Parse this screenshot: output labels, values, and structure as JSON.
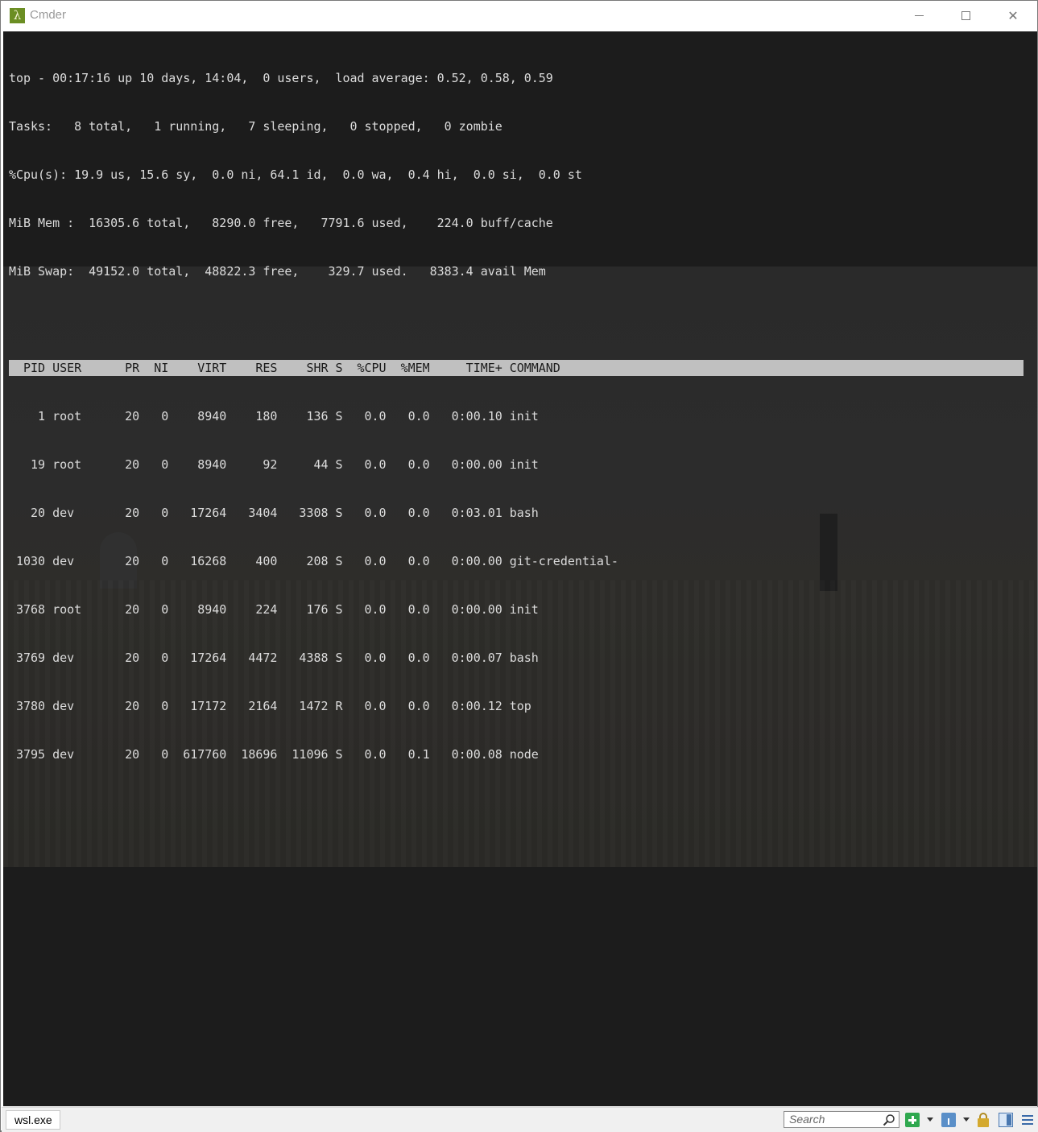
{
  "window": {
    "title": "Cmder",
    "app_icon_glyph": "λ",
    "minimize_icon": "minimize-icon",
    "maximize_icon": "maximize-icon",
    "close_glyph": "✕"
  },
  "terminal": {
    "summary_lines": [
      "top - 00:17:16 up 10 days, 14:04,  0 users,  load average: 0.52, 0.58, 0.59",
      "Tasks:   8 total,   1 running,   7 sleeping,   0 stopped,   0 zombie",
      "%Cpu(s): 19.9 us, 15.6 sy,  0.0 ni, 64.1 id,  0.0 wa,  0.4 hi,  0.0 si,  0.0 st",
      "MiB Mem :  16305.6 total,   8290.0 free,   7791.6 used,    224.0 buff/cache",
      "MiB Swap:  49152.0 total,  48822.3 free,    329.7 used.   8383.4 avail Mem"
    ],
    "header_row": "  PID USER      PR  NI    VIRT    RES    SHR S  %CPU  %MEM     TIME+ COMMAND",
    "process_rows": [
      "    1 root      20   0    8940    180    136 S   0.0   0.0   0:00.10 init",
      "   19 root      20   0    8940     92     44 S   0.0   0.0   0:00.00 init",
      "   20 dev       20   0   17264   3404   3308 S   0.0   0.0   0:03.01 bash",
      " 1030 dev       20   0   16268    400    208 S   0.0   0.0   0:00.00 git-credential-",
      " 3768 root      20   0    8940    224    176 S   0.0   0.0   0:00.00 init",
      " 3769 dev       20   0   17264   4472   4388 S   0.0   0.0   0:00.07 bash",
      " 3780 dev       20   0   17172   2164   1472 R   0.0   0.0   0:00.12 top",
      " 3795 dev       20   0  617760  18696  11096 S   0.0   0.1   0:00.08 node"
    ]
  },
  "statusbar": {
    "tab_label": "wsl.exe",
    "search_placeholder": "Search",
    "icons": [
      "search-icon",
      "new-console-plus-icon",
      "chevron-down-icon",
      "info-icon",
      "lock-icon",
      "split-view-icon",
      "menu-icon"
    ]
  },
  "colors": {
    "console_bg": "#1c1c1c",
    "console_text": "#dcdcdc",
    "header_highlight": "#c0c0c0",
    "app_icon_bg": "#6b8e23"
  }
}
